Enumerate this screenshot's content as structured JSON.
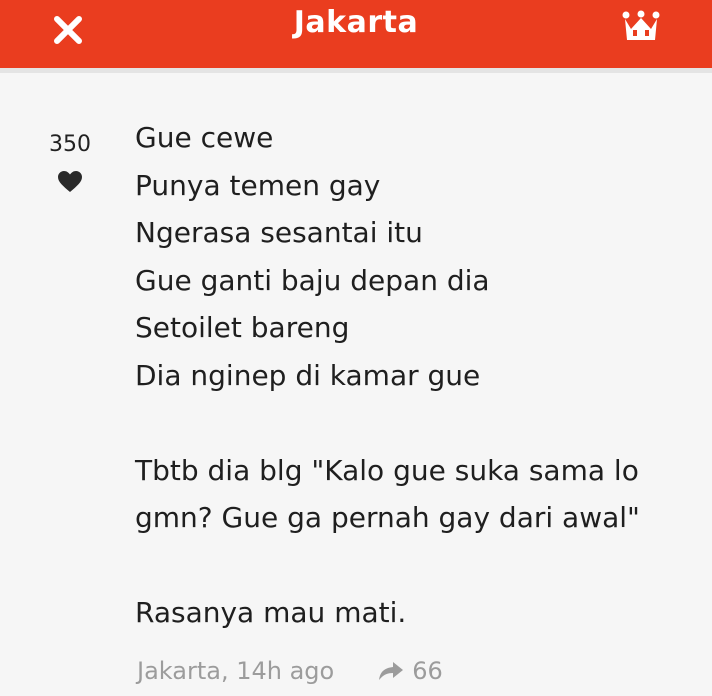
{
  "header": {
    "title": "Jakarta",
    "close_icon": "close-icon",
    "crown_icon": "crown-icon",
    "bar_color": "#ea3d1f"
  },
  "vote": {
    "count": "350",
    "icon": "heart-icon"
  },
  "post": {
    "paragraph1": [
      "Gue cewe",
      "Punya temen gay",
      "Ngerasa sesantai itu",
      "Gue ganti baju depan dia",
      "Setoilet bareng",
      "Dia nginep di kamar gue"
    ],
    "paragraph2": [
      "Tbtb dia blg \"Kalo gue suka sama lo",
      "gmn? Gue ga pernah gay dari awal\""
    ],
    "paragraph3": [
      "Rasanya mau mati."
    ]
  },
  "meta": {
    "location_time": "Jakarta, 14h ago",
    "reply_icon": "reply-icon",
    "reply_count": "66"
  }
}
